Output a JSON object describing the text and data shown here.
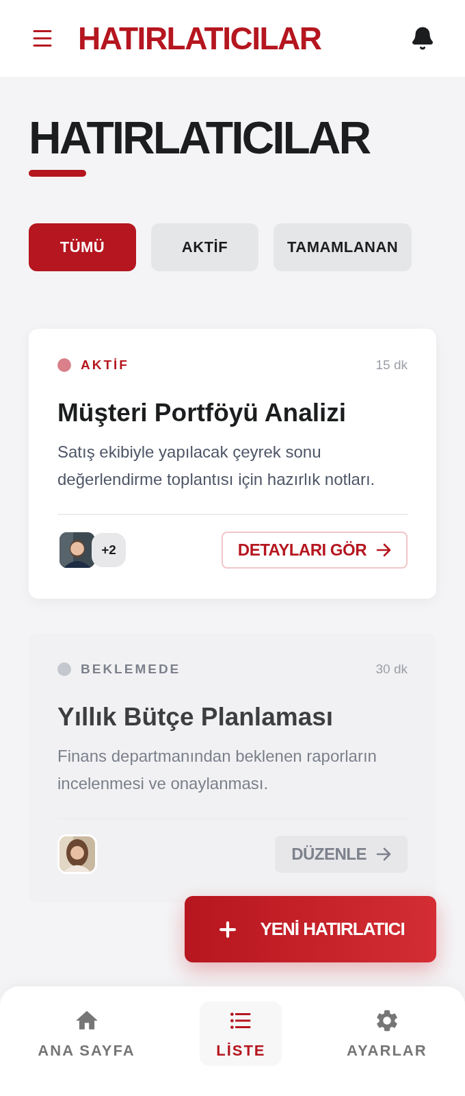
{
  "header": {
    "title": "HATIRLATICILAR"
  },
  "page_title": "HATIRLATICILAR",
  "filters": [
    {
      "label": "TÜMÜ",
      "selected": true
    },
    {
      "label": "AKTİF",
      "selected": false
    },
    {
      "label": "TAMAMLANAN",
      "selected": false
    }
  ],
  "reminders": [
    {
      "status": "AKTİF",
      "color": "#d9808a",
      "dimmed": false,
      "time": "15 dk",
      "title": "Müşteri Portföyü Analizi",
      "description": "Satış ekibiyle yapılacak çeyrek sonu değerlendirme toplantısı için hazırlık notları.",
      "extra_count": "+2",
      "action": {
        "kind": "outline",
        "label": "DETAYLARI GÖR"
      }
    },
    {
      "status": "BEKLEMEDE",
      "color": "#c4c7ce",
      "dimmed": true,
      "time": "30 dk",
      "title": "Yıllık Bütçe Planlaması",
      "description": "Finans departmanından beklenen raporların incelenmesi ve onaylanması.",
      "action": {
        "kind": "ghost",
        "label": "DÜZENLE"
      }
    }
  ],
  "fab": {
    "label": "YENİ HATIRLATICI"
  },
  "bottom_nav": [
    {
      "kind": "home",
      "label": "ANA SAYFA",
      "selected": false
    },
    {
      "kind": "list",
      "label": "LİSTE",
      "selected": true
    },
    {
      "kind": "settings",
      "label": "AYARLAR",
      "selected": false
    }
  ]
}
